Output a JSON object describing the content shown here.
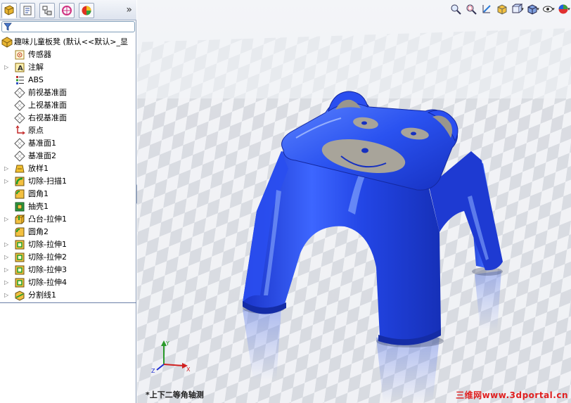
{
  "panel": {
    "tabs": [
      {
        "name": "featuremanager",
        "icon": "feature-tree-icon",
        "active": true
      },
      {
        "name": "propertymanager",
        "icon": "property-manager-icon"
      },
      {
        "name": "configurationmanager",
        "icon": "configuration-manager-icon"
      },
      {
        "name": "dimxpert",
        "icon": "dimxpert-icon"
      },
      {
        "name": "display-manager",
        "icon": "display-manager-icon"
      }
    ],
    "more_chevron": "»",
    "filter_icon": "filter-icon"
  },
  "tree": {
    "root": "趣味儿童板凳  (默认<<默认>_显",
    "items": [
      {
        "label": "传感器",
        "icon": "sensor-icon",
        "expandable": false
      },
      {
        "label": "注解",
        "icon": "annotation-icon",
        "expandable": true
      },
      {
        "label": "ABS",
        "icon": "material-icon",
        "expandable": false
      },
      {
        "label": "前视基准面",
        "icon": "plane-icon",
        "expandable": false
      },
      {
        "label": "上视基准面",
        "icon": "plane-icon",
        "expandable": false
      },
      {
        "label": "右视基准面",
        "icon": "plane-icon",
        "expandable": false
      },
      {
        "label": "原点",
        "icon": "origin-icon",
        "expandable": false
      },
      {
        "label": "基准面1",
        "icon": "plane-icon",
        "expandable": false
      },
      {
        "label": "基准面2",
        "icon": "plane-icon",
        "expandable": false
      },
      {
        "label": "放样1",
        "icon": "loft-icon",
        "expandable": true
      },
      {
        "label": "切除-扫描1",
        "icon": "cut-sweep-icon",
        "expandable": true
      },
      {
        "label": "圆角1",
        "icon": "fillet-icon",
        "expandable": false
      },
      {
        "label": "抽壳1",
        "icon": "shell-icon",
        "expandable": false
      },
      {
        "label": "凸台-拉伸1",
        "icon": "boss-extrude-icon",
        "expandable": true
      },
      {
        "label": "圆角2",
        "icon": "fillet-icon",
        "expandable": false
      },
      {
        "label": "切除-拉伸1",
        "icon": "cut-extrude-icon",
        "expandable": true
      },
      {
        "label": "切除-拉伸2",
        "icon": "cut-extrude-icon",
        "expandable": true
      },
      {
        "label": "切除-拉伸3",
        "icon": "cut-extrude-icon",
        "expandable": true
      },
      {
        "label": "切除-拉伸4",
        "icon": "cut-extrude-icon",
        "expandable": true
      },
      {
        "label": "分割线1",
        "icon": "split-line-icon",
        "expandable": true
      }
    ]
  },
  "viewport": {
    "view_label": "*上下二等角轴测",
    "watermark": "三维网www.3dportal.cn",
    "toolbar_icons": [
      "zoom-to-fit-icon",
      "zoom-to-area-icon",
      "previous-view-icon",
      "section-view-icon",
      "view-orientation-icon",
      "display-style-icon",
      "hide-show-icon",
      "appearance-icon"
    ],
    "model_color": "#1f3fd8",
    "face_color": "#a8a49a"
  }
}
